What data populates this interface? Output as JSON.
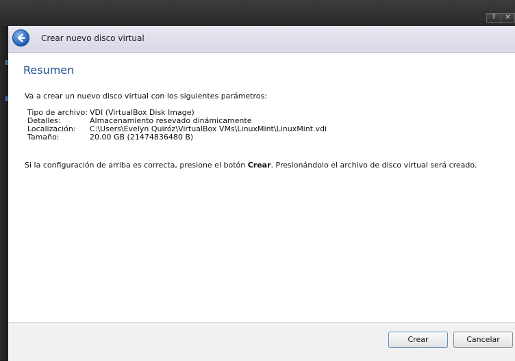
{
  "window": {
    "help_button": "?",
    "close_button": "✕"
  },
  "header": {
    "title": "Crear nuevo disco virtual"
  },
  "summary": {
    "heading": "Resumen",
    "intro": "Va a crear un nuevo disco virtual con los siguientes parámetros:",
    "params": [
      {
        "label": "Tipo de archivo:",
        "value": "VDI (VirtualBox Disk Image)"
      },
      {
        "label": "Detalles:",
        "value": "Almacenamiento resevado dinámicamente"
      },
      {
        "label": "Localización:",
        "value": "C:\\Users\\Evelyn Quiróz\\VirtualBox VMs\\LinuxMint\\LinuxMint.vdi"
      },
      {
        "label": "Tamaño:",
        "value": "20.00 GB (21474836480 B)"
      }
    ],
    "note_before": "Si la configuración de arriba es correcta, presione el botón ",
    "note_bold": "Crear",
    "note_after": ". Presionándolo el archivo de disco virtual será creado."
  },
  "footer": {
    "create_label": "Crear",
    "cancel_label": "Cancelar"
  }
}
